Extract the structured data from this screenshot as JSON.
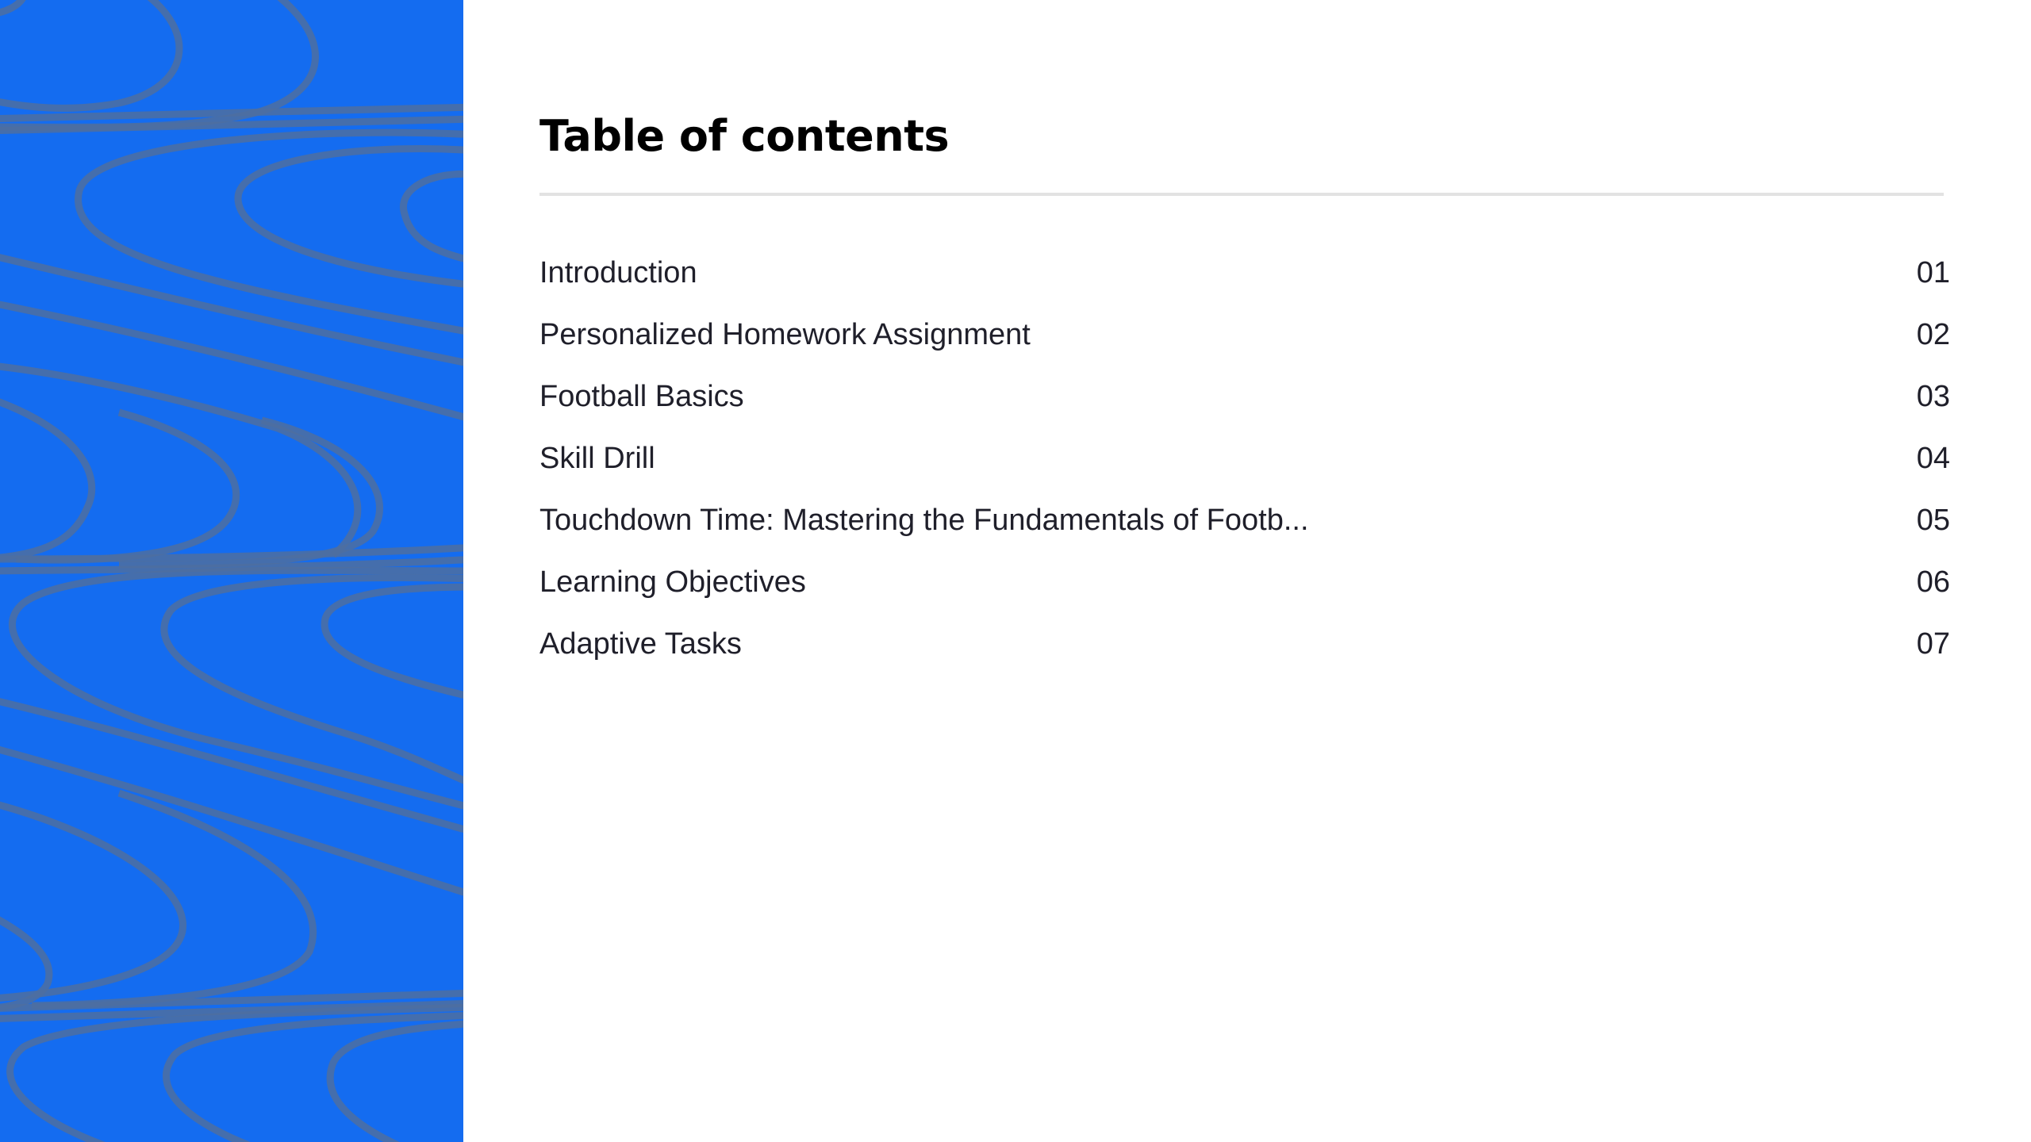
{
  "slide": {
    "title": "Table of contents",
    "accent_color": "#146cf0",
    "pattern_icon": "wave-pattern",
    "items": [
      {
        "label": "Introduction",
        "number": "01"
      },
      {
        "label": "Personalized Homework Assignment",
        "number": "02"
      },
      {
        "label": "Football Basics",
        "number": "03"
      },
      {
        "label": "Skill Drill",
        "number": "04"
      },
      {
        "label": "Touchdown Time: Mastering the Fundamentals of Footb...",
        "number": "05"
      },
      {
        "label": "Learning Objectives",
        "number": "06"
      },
      {
        "label": "Adaptive Tasks",
        "number": "07"
      }
    ]
  }
}
